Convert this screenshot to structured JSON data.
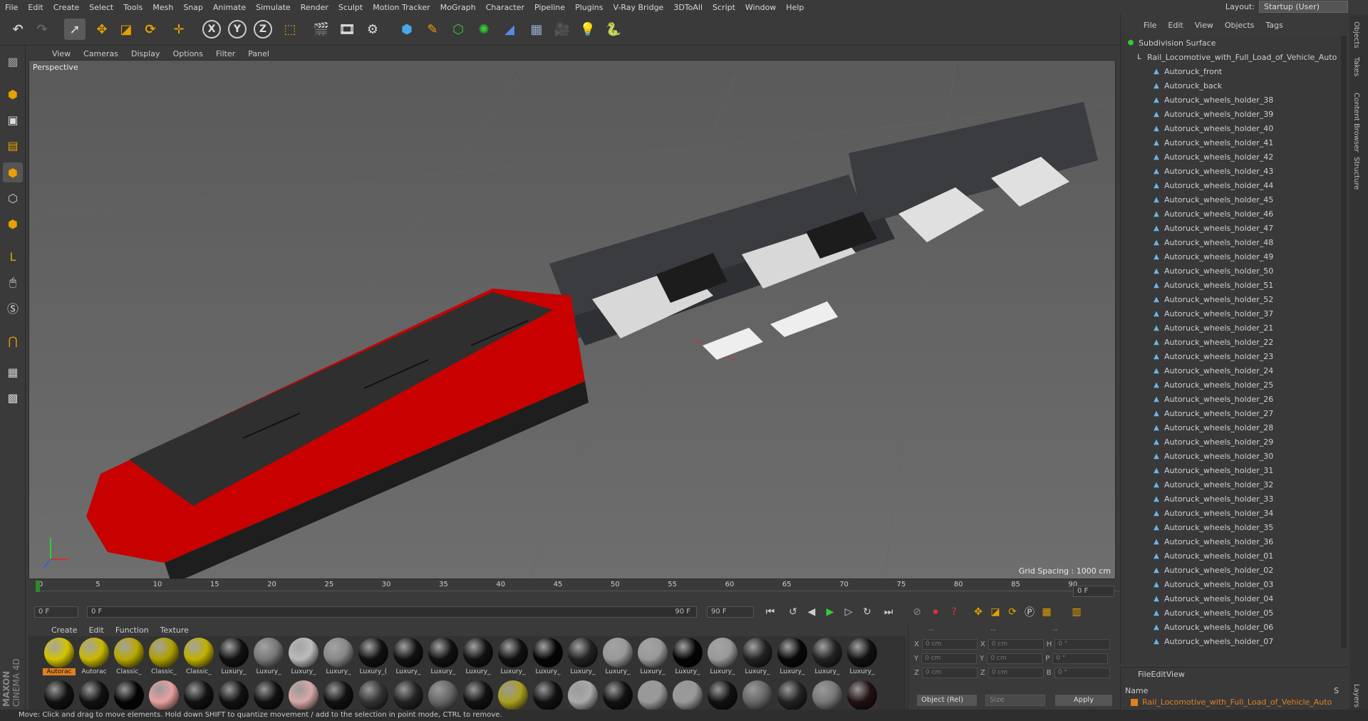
{
  "menubar": {
    "items": [
      "File",
      "Edit",
      "Create",
      "Select",
      "Tools",
      "Mesh",
      "Snap",
      "Animate",
      "Simulate",
      "Render",
      "Sculpt",
      "Motion Tracker",
      "MoGraph",
      "Character",
      "Pipeline",
      "Plugins",
      "V-Ray Bridge",
      "3DToAll",
      "Script",
      "Window",
      "Help"
    ],
    "layout_label": "Layout:",
    "layout_value": "Startup (User)"
  },
  "viewport": {
    "menu": [
      "View",
      "Cameras",
      "Display",
      "Options",
      "Filter",
      "Panel"
    ],
    "label": "Perspective",
    "grid_spacing": "Grid Spacing : 1000 cm"
  },
  "timeline": {
    "ticks": [
      "0",
      "5",
      "10",
      "15",
      "20",
      "25",
      "30",
      "35",
      "40",
      "45",
      "50",
      "55",
      "60",
      "65",
      "70",
      "75",
      "80",
      "85",
      "90"
    ],
    "current_frame": "0 F"
  },
  "transport": {
    "start": "0 F",
    "range_start": "0 F",
    "range_end": "90 F",
    "end": "90 F"
  },
  "materials": {
    "menu": [
      "Create",
      "Edit",
      "Function",
      "Texture"
    ],
    "row1": [
      {
        "label": "Autorac",
        "color": "#d4c400"
      },
      {
        "label": "Autorac",
        "color": "#c8b800"
      },
      {
        "label": "Classic_",
        "color": "#b8a800"
      },
      {
        "label": "Classic_",
        "color": "#b0a000"
      },
      {
        "label": "Classic_",
        "color": "#c0b000"
      },
      {
        "label": "Luxury_",
        "color": "#111111"
      },
      {
        "label": "Luxury_",
        "color": "#777777"
      },
      {
        "label": "Luxury_",
        "color": "#bbbbbb"
      },
      {
        "label": "Luxury_",
        "color": "#888888"
      },
      {
        "label": "Luxury_(",
        "color": "#111111"
      },
      {
        "label": "Luxury_",
        "color": "#111111"
      },
      {
        "label": "Luxury_",
        "color": "#111111"
      },
      {
        "label": "Luxury_",
        "color": "#111111"
      },
      {
        "label": "Luxury_",
        "color": "#111111"
      },
      {
        "label": "Luxury_",
        "color": "#050505"
      },
      {
        "label": "Luxury_",
        "color": "#222222"
      },
      {
        "label": "Luxury_",
        "color": "#999999"
      },
      {
        "label": "Luxury_",
        "color": "#999999"
      },
      {
        "label": "Luxury_",
        "color": "#050505"
      },
      {
        "label": "Luxury_",
        "color": "#999999"
      },
      {
        "label": "Luxury_",
        "color": "#222222"
      },
      {
        "label": "Luxury_",
        "color": "#080808"
      },
      {
        "label": "Luxury_",
        "color": "#222222"
      },
      {
        "label": "Luxury_",
        "color": "#111111"
      }
    ],
    "row2": [
      "#111111",
      "#111111",
      "#050505",
      "#e8a0a0",
      "#111111",
      "#111111",
      "#111111",
      "#d8a8a8",
      "#111111",
      "#333333",
      "#222222",
      "#666666",
      "#111111",
      "#aaa020",
      "#111111",
      "#aaaaaa",
      "#111111",
      "#999999",
      "#999999",
      "#111111",
      "#666666",
      "#222222",
      "#777777",
      "#221111"
    ]
  },
  "coords": {
    "rows": [
      {
        "a": "X",
        "v1": "0 cm",
        "b": "X",
        "v2": "0 cm",
        "c": "H",
        "v3": "0 °"
      },
      {
        "a": "Y",
        "v1": "0 cm",
        "b": "Y",
        "v2": "0 cm",
        "c": "P",
        "v3": "0 °"
      },
      {
        "a": "Z",
        "v1": "0 cm",
        "b": "Z",
        "v2": "0 cm",
        "c": "B",
        "v3": "0 °"
      }
    ],
    "mode": "Object (Rel)",
    "size": "Size",
    "apply": "Apply",
    "header1": "--",
    "header2": "--",
    "header3": "--"
  },
  "objects": {
    "menu": [
      "File",
      "Edit",
      "View",
      "Objects",
      "Tags"
    ],
    "root": "Subdivision Surface",
    "child": "Rail_Locomotive_with_Full_Load_of_Vehicle_Auto",
    "items": [
      "Autoruck_front",
      "Autoruck_back",
      "Autoruck_wheels_holder_38",
      "Autoruck_wheels_holder_39",
      "Autoruck_wheels_holder_40",
      "Autoruck_wheels_holder_41",
      "Autoruck_wheels_holder_42",
      "Autoruck_wheels_holder_43",
      "Autoruck_wheels_holder_44",
      "Autoruck_wheels_holder_45",
      "Autoruck_wheels_holder_46",
      "Autoruck_wheels_holder_47",
      "Autoruck_wheels_holder_48",
      "Autoruck_wheels_holder_49",
      "Autoruck_wheels_holder_50",
      "Autoruck_wheels_holder_51",
      "Autoruck_wheels_holder_52",
      "Autoruck_wheels_holder_37",
      "Autoruck_wheels_holder_21",
      "Autoruck_wheels_holder_22",
      "Autoruck_wheels_holder_23",
      "Autoruck_wheels_holder_24",
      "Autoruck_wheels_holder_25",
      "Autoruck_wheels_holder_26",
      "Autoruck_wheels_holder_27",
      "Autoruck_wheels_holder_28",
      "Autoruck_wheels_holder_29",
      "Autoruck_wheels_holder_30",
      "Autoruck_wheels_holder_31",
      "Autoruck_wheels_holder_32",
      "Autoruck_wheels_holder_33",
      "Autoruck_wheels_holder_34",
      "Autoruck_wheels_holder_35",
      "Autoruck_wheels_holder_36",
      "Autoruck_wheels_holder_01",
      "Autoruck_wheels_holder_02",
      "Autoruck_wheels_holder_03",
      "Autoruck_wheels_holder_04",
      "Autoruck_wheels_holder_05",
      "Autoruck_wheels_holder_06",
      "Autoruck_wheels_holder_07"
    ]
  },
  "attributes": {
    "menu": [
      "File",
      "Edit",
      "View"
    ],
    "name_header": "Name",
    "s_header": "S",
    "item": "Rail_Locomotive_with_Full_Load_of_Vehicle_Auto"
  },
  "sidetabs": [
    "Objects",
    "Takes",
    "Content Browser",
    "Structure",
    "Layers"
  ],
  "brand": {
    "line1": "MAXON",
    "line2": "CINEMA 4D"
  },
  "status": "Move: Click and drag to move elements. Hold down SHIFT to quantize movement / add to the selection in point mode, CTRL to remove.",
  "colors": {
    "accent": "#e0a000",
    "loco_red": "#c80000",
    "selection_orange": "#e08020"
  }
}
